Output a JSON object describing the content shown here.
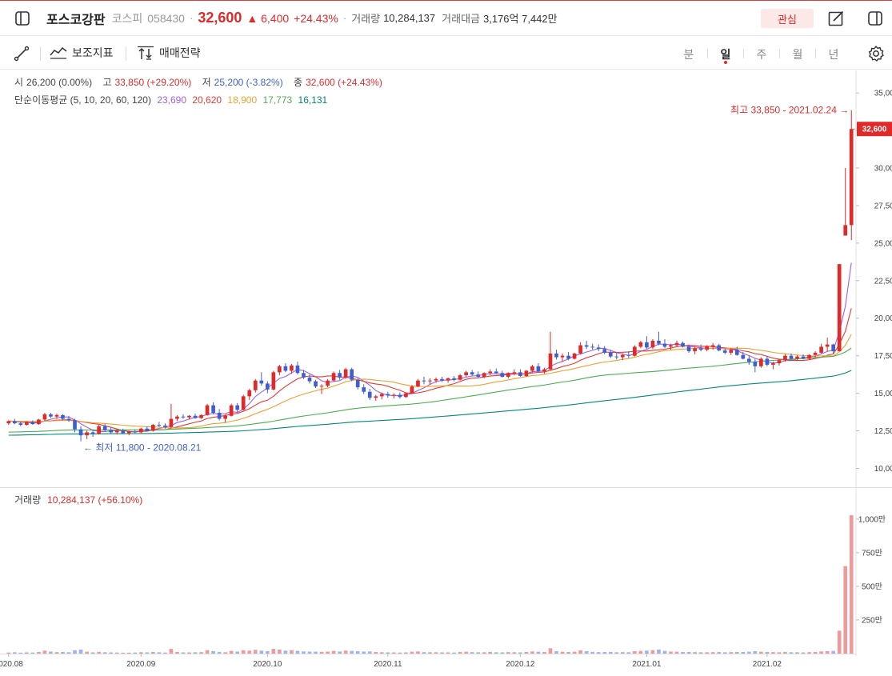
{
  "header": {
    "name": "포스코강판",
    "market": "코스피",
    "code": "058430",
    "price": "32,600",
    "change": "6,400",
    "change_rate": "+24.43%",
    "volume_label": "거래량",
    "volume_value": "10,284,137",
    "amount_label": "거래대금",
    "amount_value": "3,176억 7,442만",
    "watch_label": "관심"
  },
  "toolbar": {
    "indicator_label": "보조지표",
    "strategy_label": "매매전략",
    "periods": [
      "분",
      "일",
      "주",
      "월",
      "년"
    ],
    "active_period": "일"
  },
  "info": {
    "open_label": "시",
    "open_value": "26,200 (0.00%)",
    "high_label": "고",
    "high_value": "33,850 (+29.20%)",
    "low_label": "저",
    "low_value": "25,200 (-3.82%)",
    "close_label": "종",
    "close_value": "32,600 (+24.43%)",
    "ma_label": "단순이동평균 (5, 10, 20, 60, 120)",
    "ma_values": [
      "23,690",
      "20,620",
      "18,900",
      "17,773",
      "16,131"
    ],
    "ma_colors": [
      "#a45ee5",
      "#e53935",
      "#f0a030",
      "#4caf50",
      "#00897b"
    ]
  },
  "volume_info": {
    "label": "거래량",
    "value": "10,284,137 (+56.10%)"
  },
  "chart_data": {
    "type": "candlestick",
    "up_color": "#e02a2a",
    "down_color": "#3f5fd0",
    "price_ylim": [
      8800,
      36500
    ],
    "price_ticks": [
      "35,000",
      "32,500",
      "30,000",
      "27,500",
      "25,000",
      "22,500",
      "20,000",
      "17,500",
      "15,000",
      "12,500",
      "10,000"
    ],
    "price_tick_values": [
      35000,
      32500,
      30000,
      27500,
      25000,
      22500,
      20000,
      17500,
      15000,
      12500,
      10000
    ],
    "volume_ylim": [
      0,
      1100
    ],
    "volume_ticks": [
      "1,000만",
      "750만",
      "500만",
      "250만"
    ],
    "volume_tick_values": [
      1000,
      750,
      500,
      250
    ],
    "x_labels": [
      "2020.08",
      "2020.09",
      "2020.10",
      "2020.11",
      "2020.12",
      "2021.01",
      "2021.02"
    ],
    "x_label_index": [
      0,
      22,
      43,
      63,
      85,
      106,
      126
    ],
    "current_price_label": "32,600",
    "current_price": 32600,
    "max_annotation": "최고 33,850 - 2021.02.24 →",
    "min_annotation": "← 최저 11,800 - 2020.08.21",
    "candles": [
      [
        13000,
        13200,
        12900,
        13150,
        8
      ],
      [
        13150,
        13300,
        12950,
        13000,
        10
      ],
      [
        13000,
        13100,
        12800,
        12900,
        7
      ],
      [
        12900,
        13150,
        12850,
        13100,
        9
      ],
      [
        13100,
        13200,
        12900,
        12950,
        8
      ],
      [
        12950,
        13300,
        12900,
        13250,
        12
      ],
      [
        13250,
        13700,
        13150,
        13600,
        22
      ],
      [
        13600,
        13700,
        13350,
        13450,
        15
      ],
      [
        13450,
        13650,
        13300,
        13550,
        11
      ],
      [
        13550,
        13600,
        13200,
        13300,
        12
      ],
      [
        13300,
        13500,
        13100,
        13200,
        10
      ],
      [
        13200,
        13300,
        12400,
        12600,
        25
      ],
      [
        12600,
        12800,
        11800,
        12200,
        30
      ],
      [
        12200,
        12500,
        11950,
        12400,
        14
      ],
      [
        12400,
        12600,
        12100,
        12300,
        9
      ],
      [
        12300,
        12900,
        12250,
        12800,
        13
      ],
      [
        12800,
        12950,
        12450,
        12550,
        10
      ],
      [
        12550,
        12700,
        12300,
        12400,
        9
      ],
      [
        12400,
        12600,
        12250,
        12500,
        8
      ],
      [
        12500,
        12650,
        12300,
        12350,
        7
      ],
      [
        12350,
        12500,
        12200,
        12450,
        7
      ],
      [
        12450,
        12600,
        12300,
        12400,
        8
      ],
      [
        12400,
        12700,
        12350,
        12650,
        10
      ],
      [
        12650,
        12800,
        12450,
        12500,
        9
      ],
      [
        12500,
        12950,
        12450,
        12900,
        12
      ],
      [
        12900,
        13100,
        12750,
        12850,
        10
      ],
      [
        12850,
        13000,
        12650,
        12750,
        8
      ],
      [
        12750,
        14300,
        12700,
        13300,
        35
      ],
      [
        13300,
        13550,
        13150,
        13450,
        12
      ],
      [
        13450,
        13600,
        13300,
        13400,
        9
      ],
      [
        13400,
        13550,
        13250,
        13500,
        9
      ],
      [
        13500,
        13650,
        13300,
        13350,
        10
      ],
      [
        13350,
        13600,
        13300,
        13550,
        11
      ],
      [
        13550,
        14300,
        13500,
        14200,
        25
      ],
      [
        14200,
        14400,
        13600,
        13700,
        18
      ],
      [
        13700,
        13950,
        13200,
        13300,
        12
      ],
      [
        13300,
        13600,
        13050,
        13500,
        10
      ],
      [
        13500,
        14300,
        13450,
        14200,
        20
      ],
      [
        14200,
        14350,
        13750,
        13900,
        15
      ],
      [
        13900,
        14900,
        13850,
        14800,
        25
      ],
      [
        14800,
        15300,
        14550,
        15200,
        22
      ],
      [
        15200,
        15950,
        15050,
        15850,
        28
      ],
      [
        15850,
        16400,
        15500,
        15650,
        22
      ],
      [
        15650,
        15800,
        15000,
        15250,
        18
      ],
      [
        15250,
        16500,
        15200,
        16400,
        35
      ],
      [
        16400,
        16900,
        16200,
        16800,
        30
      ],
      [
        16800,
        17000,
        16400,
        16500,
        22
      ],
      [
        16500,
        16950,
        16300,
        16850,
        25
      ],
      [
        16850,
        17100,
        16250,
        16350,
        20
      ],
      [
        16350,
        16550,
        15950,
        16050,
        16
      ],
      [
        16050,
        16250,
        15650,
        15800,
        15
      ],
      [
        15800,
        15900,
        15350,
        15450,
        14
      ],
      [
        15450,
        15600,
        14950,
        15500,
        13
      ],
      [
        15500,
        15950,
        15400,
        15850,
        15
      ],
      [
        15850,
        16450,
        15800,
        16350,
        20
      ],
      [
        16350,
        16550,
        15900,
        16050,
        16
      ],
      [
        16050,
        16700,
        15950,
        16600,
        22
      ],
      [
        16600,
        16700,
        15800,
        15900,
        20
      ],
      [
        15900,
        16000,
        15250,
        15400,
        18
      ],
      [
        15400,
        15600,
        14950,
        15100,
        15
      ],
      [
        15100,
        15300,
        14550,
        14700,
        16
      ],
      [
        14700,
        14900,
        14500,
        14800,
        12
      ],
      [
        14800,
        15050,
        14600,
        14950,
        10
      ],
      [
        14950,
        15100,
        14700,
        14850,
        9
      ],
      [
        14850,
        15000,
        14650,
        14900,
        9
      ],
      [
        14900,
        15050,
        14650,
        14750,
        8
      ],
      [
        14750,
        15050,
        14700,
        15000,
        9
      ],
      [
        15000,
        15550,
        14950,
        15450,
        14
      ],
      [
        15450,
        15950,
        15400,
        15850,
        16
      ],
      [
        15850,
        16100,
        15600,
        15800,
        11
      ],
      [
        15800,
        16000,
        15600,
        15850,
        10
      ],
      [
        15850,
        16050,
        15700,
        15950,
        10
      ],
      [
        15950,
        16100,
        15750,
        15850,
        9
      ],
      [
        15850,
        16050,
        15700,
        16000,
        9
      ],
      [
        16000,
        16150,
        15800,
        15900,
        8
      ],
      [
        15900,
        16300,
        15850,
        16200,
        12
      ],
      [
        16200,
        16500,
        16100,
        16400,
        14
      ],
      [
        16400,
        16550,
        16150,
        16250,
        11
      ],
      [
        16250,
        16450,
        16050,
        16100,
        10
      ],
      [
        16100,
        16400,
        16000,
        16350,
        10
      ],
      [
        16350,
        16600,
        16200,
        16450,
        12
      ],
      [
        16450,
        16650,
        16300,
        16350,
        10
      ],
      [
        16350,
        16500,
        16050,
        16100,
        9
      ],
      [
        16100,
        16400,
        16000,
        16350,
        11
      ],
      [
        16350,
        16600,
        16200,
        16400,
        10
      ],
      [
        16400,
        16600,
        16100,
        16150,
        9
      ],
      [
        16150,
        16550,
        16100,
        16500,
        12
      ],
      [
        16500,
        16900,
        16400,
        16800,
        16
      ],
      [
        16800,
        17000,
        16400,
        16450,
        14
      ],
      [
        16450,
        16700,
        16300,
        16600,
        12
      ],
      [
        16600,
        19100,
        16550,
        17650,
        40
      ],
      [
        17650,
        17900,
        17250,
        17400,
        18
      ],
      [
        17400,
        17650,
        17100,
        17500,
        14
      ],
      [
        17500,
        17750,
        17200,
        17300,
        12
      ],
      [
        17300,
        17700,
        17250,
        17650,
        14
      ],
      [
        17650,
        18400,
        17600,
        18200,
        24
      ],
      [
        18200,
        18500,
        17950,
        18100,
        18
      ],
      [
        18100,
        18300,
        17900,
        18050,
        13
      ],
      [
        18050,
        18250,
        17800,
        17950,
        11
      ],
      [
        17950,
        18150,
        17600,
        17700,
        12
      ],
      [
        17700,
        17900,
        17350,
        17450,
        12
      ],
      [
        17450,
        17700,
        17250,
        17400,
        10
      ],
      [
        17400,
        17650,
        17200,
        17550,
        11
      ],
      [
        17550,
        17800,
        17350,
        17500,
        10
      ],
      [
        17500,
        18200,
        17450,
        18100,
        18
      ],
      [
        18100,
        18500,
        18000,
        18400,
        20
      ],
      [
        18400,
        18800,
        17950,
        18050,
        22
      ],
      [
        18050,
        18600,
        17950,
        18500,
        25
      ],
      [
        18500,
        19100,
        18200,
        18300,
        30
      ],
      [
        18300,
        18600,
        18000,
        18100,
        20
      ],
      [
        18100,
        18300,
        17900,
        18200,
        15
      ],
      [
        18200,
        18500,
        18100,
        18350,
        14
      ],
      [
        18350,
        18450,
        18050,
        18100,
        12
      ],
      [
        18100,
        18250,
        17700,
        17800,
        12
      ],
      [
        17800,
        18100,
        17600,
        18000,
        11
      ],
      [
        18000,
        18250,
        17800,
        17900,
        10
      ],
      [
        17900,
        18200,
        17800,
        18100,
        10
      ],
      [
        18100,
        18350,
        17900,
        18200,
        11
      ],
      [
        18200,
        18300,
        17800,
        17850,
        12
      ],
      [
        17850,
        18000,
        17600,
        17700,
        10
      ],
      [
        17700,
        18000,
        17550,
        17900,
        11
      ],
      [
        17900,
        18100,
        17500,
        17550,
        12
      ],
      [
        17550,
        17750,
        17250,
        17300,
        12
      ],
      [
        17300,
        17500,
        16900,
        17100,
        14
      ],
      [
        17100,
        17300,
        16400,
        16800,
        18
      ],
      [
        16800,
        17400,
        16700,
        17300,
        14
      ],
      [
        17300,
        17500,
        16800,
        16900,
        12
      ],
      [
        16900,
        17100,
        16600,
        17000,
        11
      ],
      [
        17000,
        17250,
        16850,
        17200,
        10
      ],
      [
        17200,
        17600,
        17100,
        17500,
        12
      ],
      [
        17500,
        17650,
        17200,
        17300,
        10
      ],
      [
        17300,
        17550,
        17200,
        17450,
        10
      ],
      [
        17450,
        17600,
        17250,
        17300,
        9
      ],
      [
        17300,
        17600,
        17250,
        17550,
        11
      ],
      [
        17550,
        17800,
        17400,
        17700,
        12
      ],
      [
        17700,
        18300,
        17650,
        18100,
        16
      ],
      [
        18100,
        18700,
        17800,
        18250,
        18
      ],
      [
        18250,
        18300,
        17650,
        17800,
        20
      ],
      [
        17800,
        23600,
        17800,
        23600,
        170
      ],
      [
        25500,
        30000,
        25500,
        26200,
        650
      ],
      [
        26200,
        33850,
        25200,
        32600,
        1028
      ]
    ]
  }
}
